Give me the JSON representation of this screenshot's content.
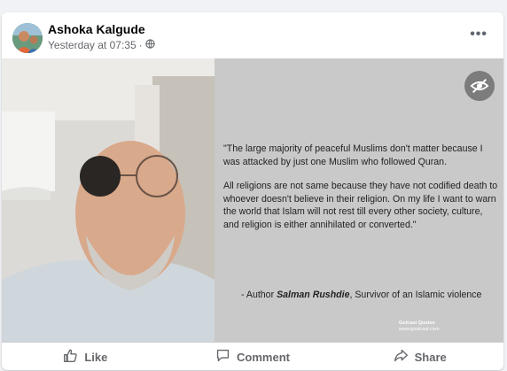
{
  "post": {
    "author": "Ashoka Kalgude",
    "timestamp": "Yesterday at 07:35",
    "separator": "·",
    "privacy_icon": "globe-icon",
    "more_icon": "more-dots-icon",
    "more_label": "•••"
  },
  "image": {
    "quote_paragraph_1": "\"The large majority of peaceful Muslims don't matter because I was attacked by just one Muslim who followed Quran.",
    "quote_paragraph_2": "All religions are not same because they have not codified death to whoever doesn't believe in their religion. On my life I want to warn the world that Islam will not rest till every other society, culture, and religion is either annihilated or converted.\"",
    "attribution_prefix": "- Author",
    "attribution_name": "Salman Rushdie",
    "attribution_suffix": ", Survivor of an Islamic violence",
    "watermark_title": "Golcast Quotes",
    "watermark_url": "www.goalcast.com",
    "eye_icon": "eye-slash-icon"
  },
  "actions": [
    {
      "label": "Like",
      "icon": "thumbs-up-icon"
    },
    {
      "label": "Comment",
      "icon": "comment-icon"
    },
    {
      "label": "Share",
      "icon": "share-icon"
    }
  ],
  "colors": {
    "page_bg": "#f0f2f5",
    "card_bg": "#ffffff",
    "quote_panel_bg": "#c9c9c9",
    "secondary_text": "#65676b"
  }
}
